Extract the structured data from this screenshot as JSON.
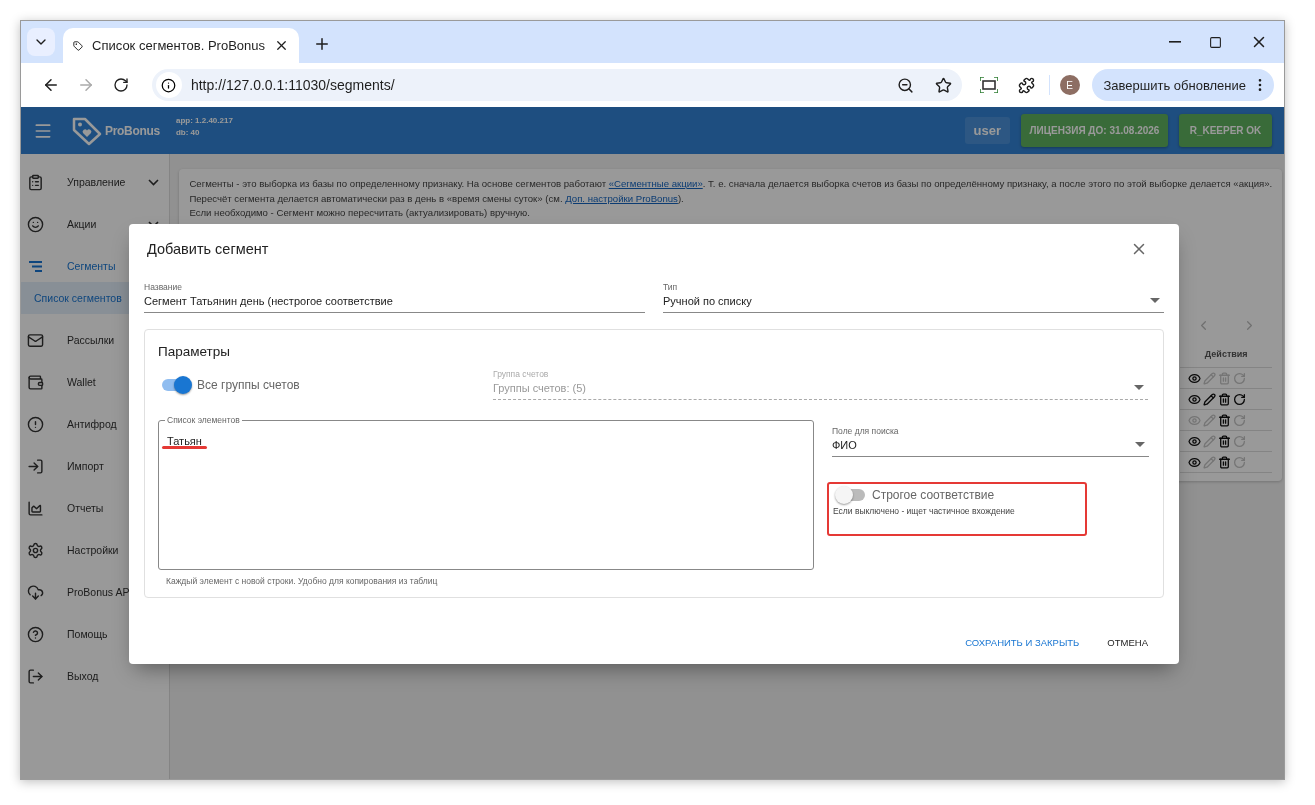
{
  "browser": {
    "tab_title": "Список сегментов. ProBonus",
    "url": "http://127.0.0.1:11030/segments/",
    "profile_initial": "E",
    "update_button": "Завершить обновление"
  },
  "header": {
    "brand": "ProBonus",
    "app_version": "app: 1.2.40.217",
    "db_version": "db: 40",
    "user": "user",
    "license": "ЛИЦЕНЗИЯ ДО: 31.08.2026",
    "keeper_status": "R_KEEPER OK"
  },
  "sidebar": {
    "items": [
      {
        "label": "Управление",
        "selected": false,
        "submenu": true
      },
      {
        "label": "Акции",
        "selected": false,
        "submenu": true
      },
      {
        "label": "Сегменты",
        "selected": true,
        "children": [
          {
            "label": "Список сегментов",
            "selected": true
          }
        ]
      },
      {
        "label": "Рассылки",
        "selected": false
      },
      {
        "label": "Wallet",
        "selected": false
      },
      {
        "label": "Антифрод",
        "selected": false
      },
      {
        "label": "Импорт",
        "selected": false
      },
      {
        "label": "Отчеты",
        "selected": false
      },
      {
        "label": "Настройки",
        "selected": false
      },
      {
        "label": "ProBonus AP",
        "selected": false
      },
      {
        "label": "Помощь",
        "selected": false
      },
      {
        "label": "Выход",
        "selected": false
      }
    ]
  },
  "info": {
    "lines": [
      [
        {
          "text": "Сегменты - это выборка из базы по определенному признаку. На основе сегментов работают ",
          "link": false
        },
        {
          "text": "«Сегментные акции»",
          "link": true
        },
        {
          "text": ". Т. е. сначала делается выборка счетов из базы по определённому признаку, а после этого по этой выборке делается «акция».",
          "link": false
        }
      ],
      [
        {
          "text": "Пересчёт сегмента делается автоматически раз в день в «время смены суток» (см. ",
          "link": false
        },
        {
          "text": "Доп. настройки ProBonus",
          "link": true
        },
        {
          "text": ").",
          "link": false
        }
      ],
      [
        {
          "text": "Если необходимо - Сегмент можно пересчитать (актуализировать) вручную.",
          "link": false
        }
      ]
    ]
  },
  "table": {
    "actions_header": "Действия",
    "rows": [
      {
        "actions": [
          {
            "kind": "view",
            "enabled": true
          },
          {
            "kind": "edit",
            "enabled": false
          },
          {
            "kind": "delete",
            "enabled": false
          },
          {
            "kind": "recalc",
            "enabled": false
          }
        ]
      },
      {
        "actions": [
          {
            "kind": "view",
            "enabled": true
          },
          {
            "kind": "edit",
            "enabled": true
          },
          {
            "kind": "delete",
            "enabled": true
          },
          {
            "kind": "recalc",
            "enabled": true
          }
        ]
      },
      {
        "actions": [
          {
            "kind": "view",
            "enabled": false
          },
          {
            "kind": "edit",
            "enabled": false
          },
          {
            "kind": "delete",
            "enabled": true
          },
          {
            "kind": "recalc",
            "enabled": false
          }
        ]
      },
      {
        "actions": [
          {
            "kind": "view",
            "enabled": true
          },
          {
            "kind": "edit",
            "enabled": false
          },
          {
            "kind": "delete",
            "enabled": true
          },
          {
            "kind": "recalc",
            "enabled": false
          }
        ]
      },
      {
        "actions": [
          {
            "kind": "view",
            "enabled": true
          },
          {
            "kind": "edit",
            "enabled": false
          },
          {
            "kind": "delete",
            "enabled": true
          },
          {
            "kind": "recalc",
            "enabled": false
          }
        ]
      }
    ]
  },
  "dialog": {
    "title": "Добавить сегмент",
    "name_field": {
      "label": "Название",
      "value": "Сегмент Татьянин день (нестрогое соответствие"
    },
    "type_field": {
      "label": "Тип",
      "value": "Ручной по списку"
    },
    "params": {
      "title": "Параметры",
      "all_groups": {
        "label": "Все группы счетов",
        "on": true
      },
      "group_select": {
        "label": "Группа счетов",
        "value": "Группы счетов: (5)",
        "disabled": true
      },
      "elements": {
        "label": "Список элементов",
        "value": "Татьян",
        "helper": "Каждый элемент с новой строки. Удобно для копирования из таблиц",
        "marked": true
      },
      "search_field": {
        "label": "Поле для поиска",
        "value": "ФИО"
      },
      "strict": {
        "label": "Строгое соответствие",
        "on": false,
        "helper": "Если выключено - ищет частичное вхождение",
        "highlighted": true
      }
    },
    "buttons": [
      {
        "label": "СОХРАНИТЬ И ЗАКРЫТЬ",
        "kind": "primary"
      },
      {
        "label": "ОТМЕНА",
        "kind": "secondary"
      }
    ]
  }
}
